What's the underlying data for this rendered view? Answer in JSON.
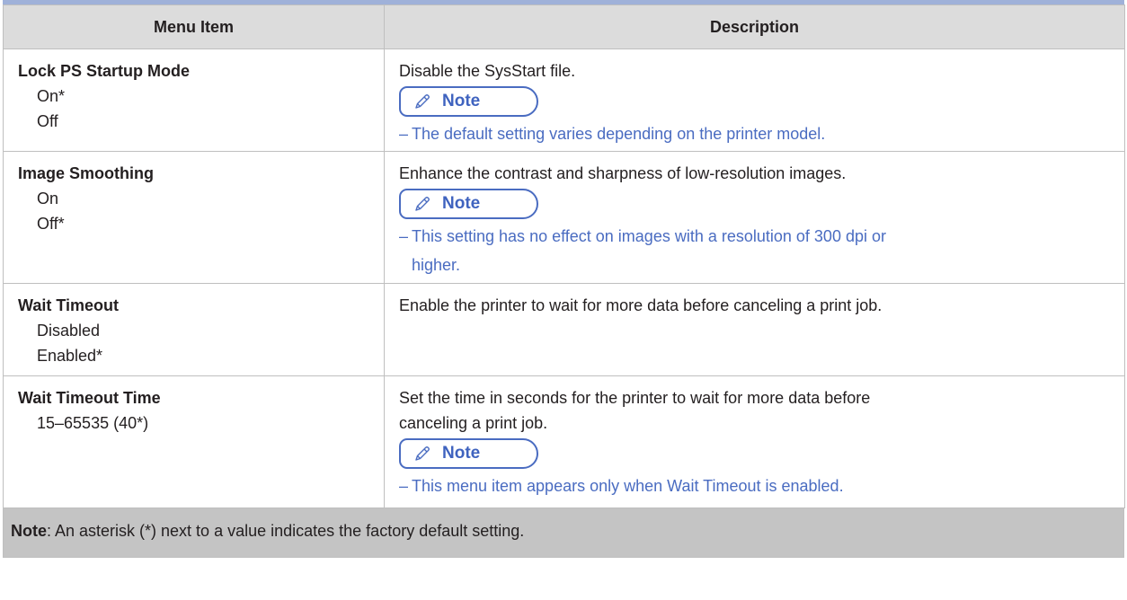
{
  "table": {
    "header": {
      "col1": "Menu Item",
      "col2": "Description"
    },
    "rows": [
      {
        "name": "Lock PS Startup Mode",
        "options": [
          "On*",
          "Off"
        ],
        "description": "Disable the SysStart file.",
        "note_label": "Note",
        "note_line1": "The default setting varies depending on the printer model.",
        "note_line2": ""
      },
      {
        "name": "Image Smoothing",
        "options": [
          "On",
          "Off*"
        ],
        "description": "Enhance the contrast and sharpness of low-resolution images.",
        "note_label": "Note",
        "note_line1": "This setting has no effect on images with a resolution of 300 dpi or",
        "note_line2": "higher."
      },
      {
        "name": "Wait Timeout",
        "options": [
          "Disabled",
          "Enabled*"
        ],
        "description": "Enable the printer to wait for more data before canceling a print job."
      },
      {
        "name": "Wait Timeout Time",
        "options": [
          "15–65535 (40*)"
        ],
        "description_line1": "Set the time in seconds for the printer to wait for more data before",
        "description_line2": "canceling a print job.",
        "note_label": "Note",
        "note_line1": "This menu item appears only when Wait Timeout is enabled."
      }
    ]
  },
  "footer": {
    "label": "Note",
    "text": ": An asterisk (*) next to a value indicates the factory default setting."
  },
  "note_dash": "–",
  "colors": {
    "accent_blue": "#4a6cc1",
    "header_bg": "#dcdcdc",
    "footer_bg": "#c4c4c4",
    "top_rule": "#9fb1d9"
  },
  "icons": {
    "note": "pencil-icon"
  }
}
